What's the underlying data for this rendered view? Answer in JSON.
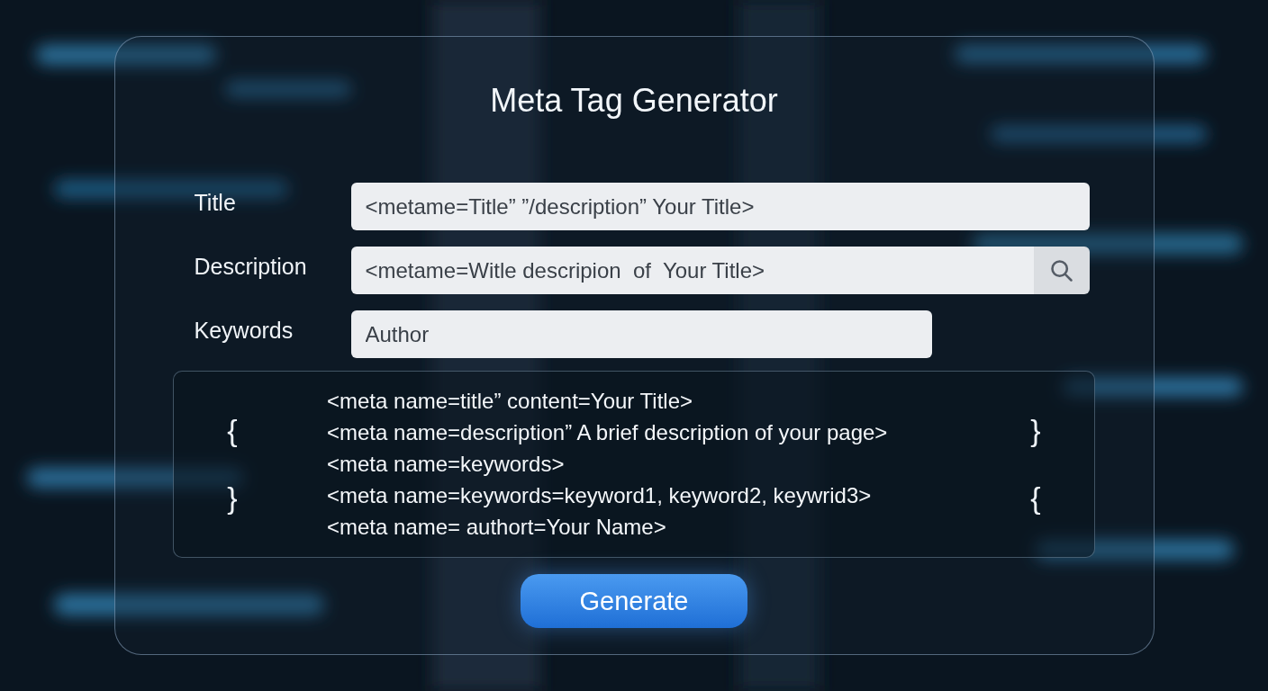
{
  "title": "Meta Tag Generator",
  "fields": [
    {
      "label": "Title",
      "value": "<metame=Title” ”/description” Your Title>",
      "kind": "text"
    },
    {
      "label": "Description",
      "value": "<metame=Witle descripion  of  Your Title>",
      "kind": "search"
    },
    {
      "label": "Keywords",
      "value": "Author",
      "kind": "short"
    }
  ],
  "code_box": {
    "braces_left": [
      "{",
      "}"
    ],
    "braces_right": [
      "}",
      "{"
    ],
    "lines": [
      "<meta name=title” content=Your Title>",
      "<meta name=description” A brief description of your page>",
      "<meta name=keywords>",
      "<meta name=keywords=keyword1, keyword2, keywrid3>",
      "<meta name= authort=Your Name>"
    ]
  },
  "button": "Generate"
}
